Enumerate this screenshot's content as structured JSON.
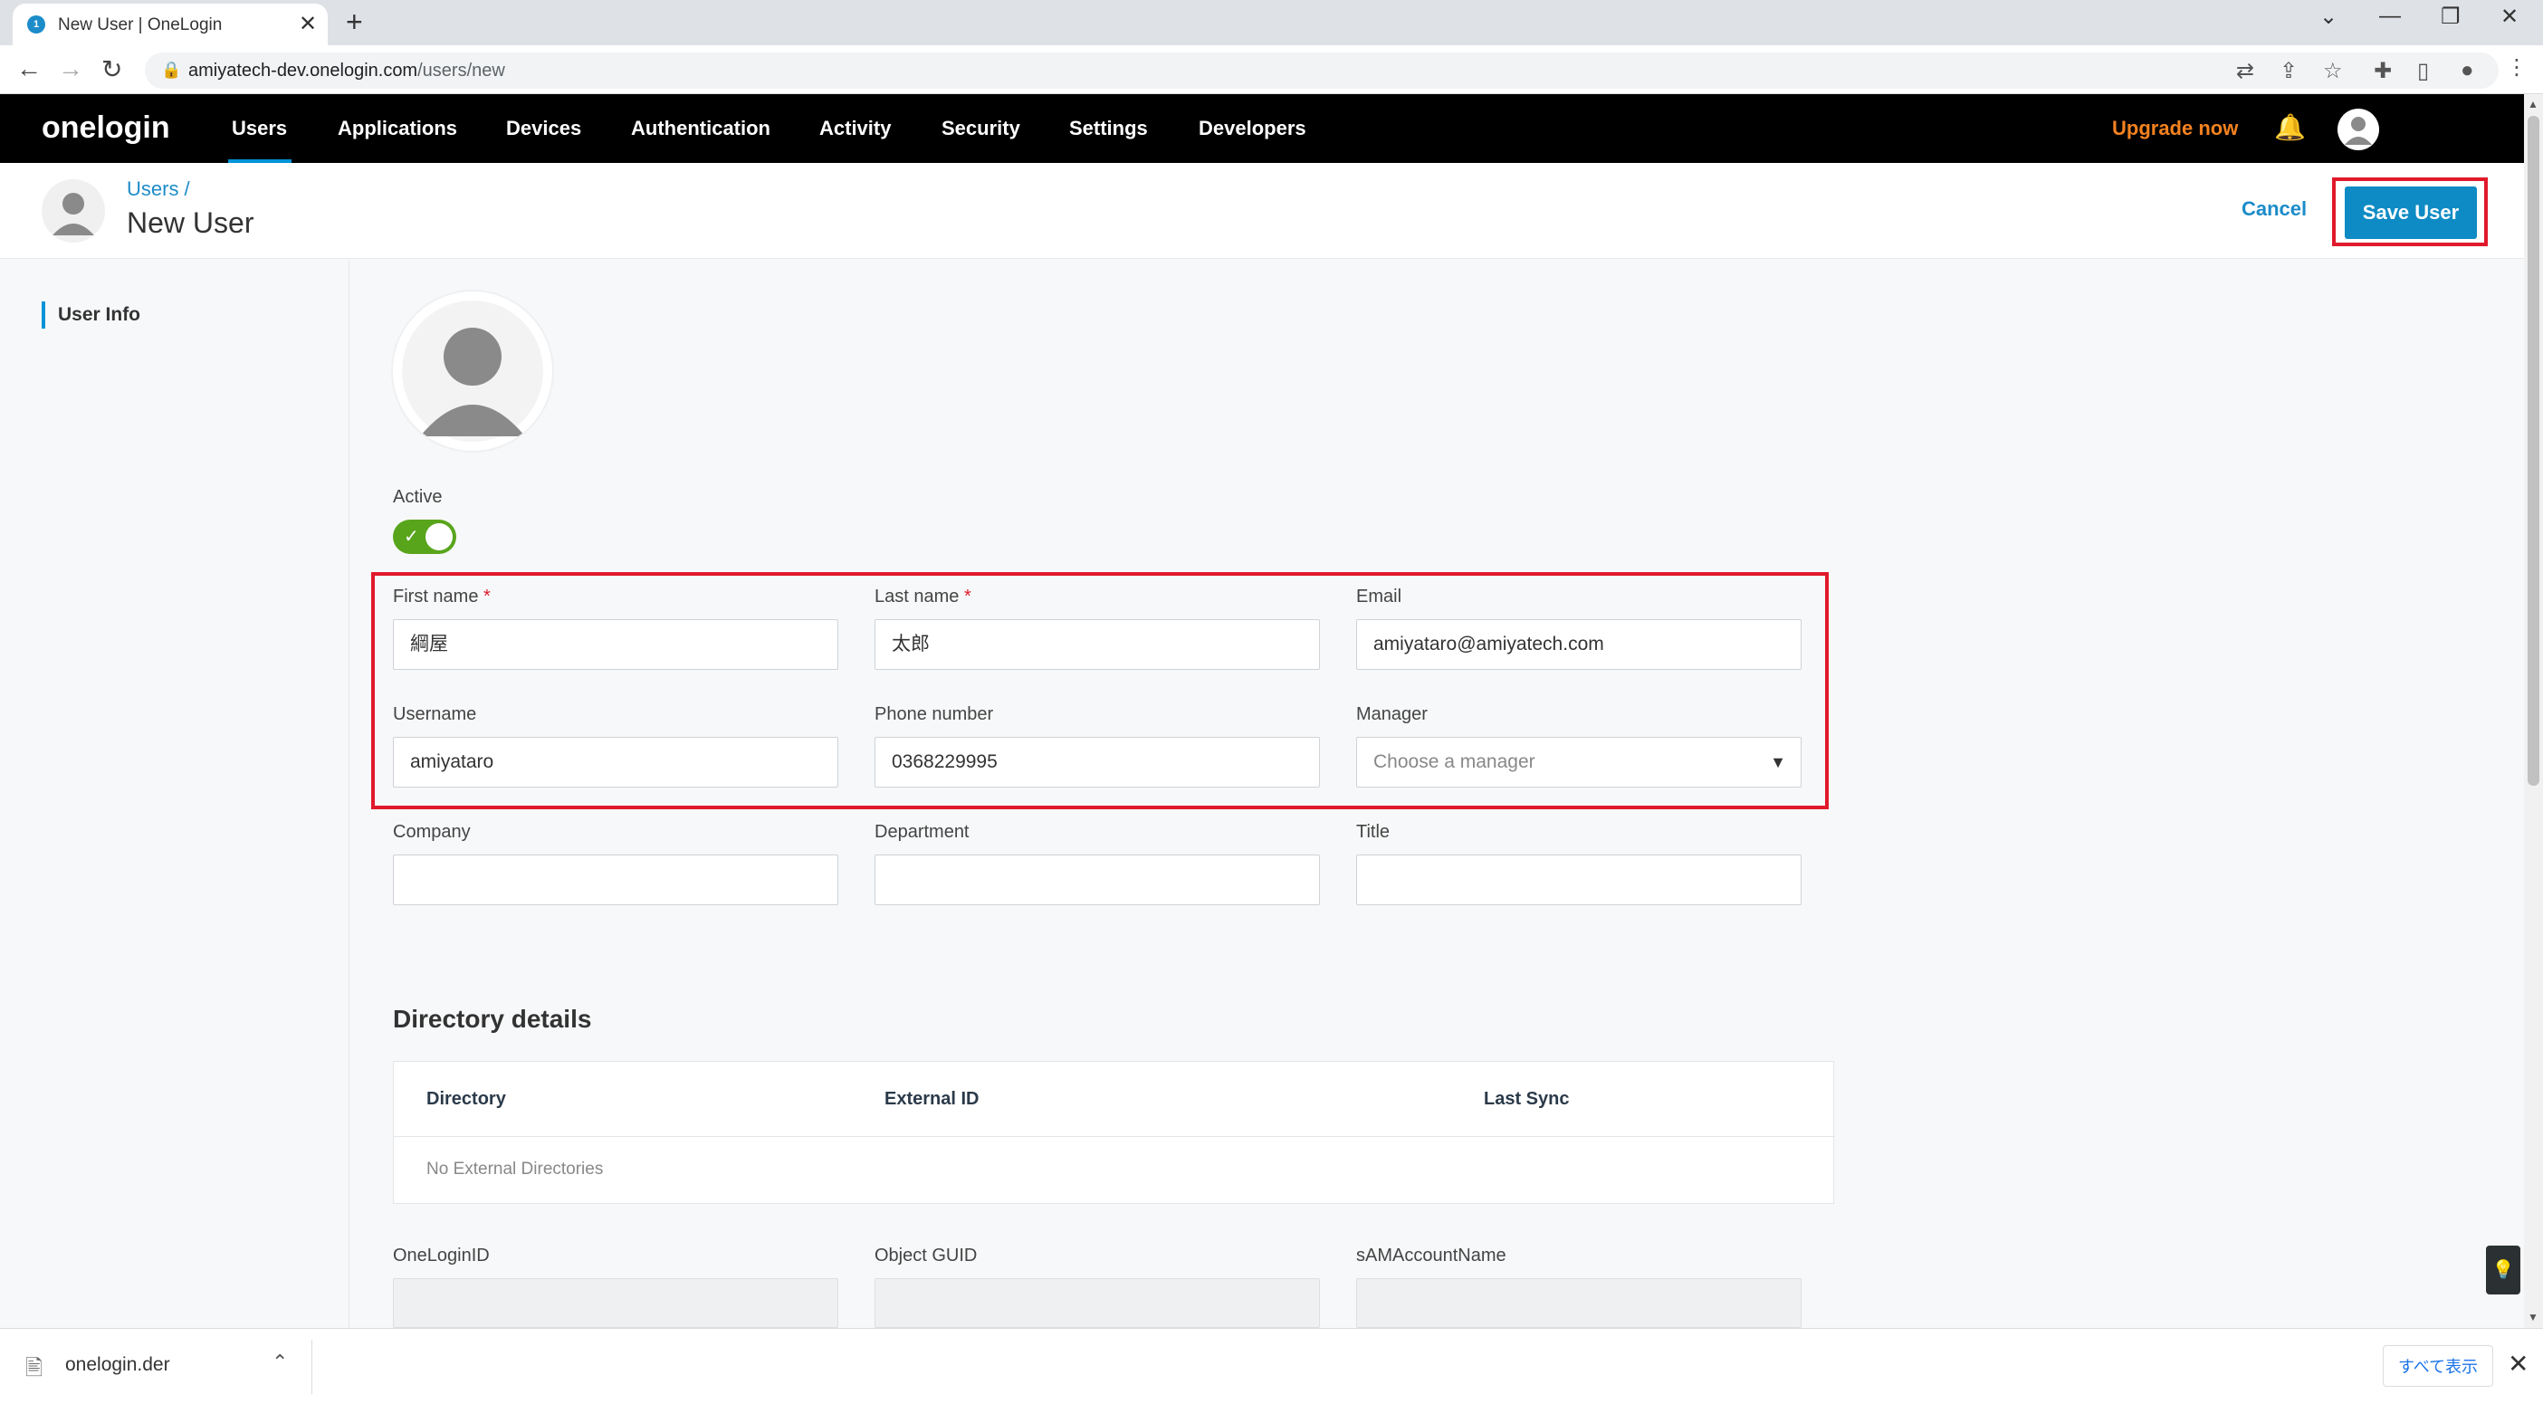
{
  "browser": {
    "tab_title": "New User | OneLogin",
    "url_host": "amiyatech-dev.onelogin.com",
    "url_path": "/users/new"
  },
  "topnav": {
    "logo": "onelogin",
    "items": [
      "Users",
      "Applications",
      "Devices",
      "Authentication",
      "Activity",
      "Security",
      "Settings",
      "Developers"
    ],
    "active": "Users",
    "upgrade": "Upgrade now"
  },
  "header": {
    "breadcrumb": "Users /",
    "title": "New User",
    "cancel": "Cancel",
    "save": "Save User"
  },
  "sidebar": {
    "items": [
      "User Info"
    ]
  },
  "form": {
    "active_label": "Active",
    "active": true,
    "first_name": {
      "label": "First name",
      "required": "*",
      "value": "綱屋"
    },
    "last_name": {
      "label": "Last name",
      "required": "*",
      "value": "太郎"
    },
    "email": {
      "label": "Email",
      "value": "amiyataro@amiyatech.com"
    },
    "username": {
      "label": "Username",
      "value": "amiyataro"
    },
    "phone": {
      "label": "Phone number",
      "value": "0368229995"
    },
    "manager": {
      "label": "Manager",
      "placeholder": "Choose a manager"
    },
    "company": {
      "label": "Company",
      "value": ""
    },
    "department": {
      "label": "Department",
      "value": ""
    },
    "title": {
      "label": "Title",
      "value": ""
    }
  },
  "directory": {
    "section_title": "Directory details",
    "columns": [
      "Directory",
      "External ID",
      "Last Sync"
    ],
    "empty": "No External Directories",
    "fields": {
      "onelogin_id": "OneLoginID",
      "object_guid": "Object GUID",
      "sam": "sAMAccountName"
    }
  },
  "downloads": {
    "file": "onelogin.der",
    "show_all": "すべて表示"
  },
  "icons": {
    "toggle_check": "✓",
    "bell": "bell-icon",
    "help": "lightbulb-icon"
  },
  "colors": {
    "brand_blue": "#0e8bc4",
    "toggle_green": "#58a51c",
    "highlight_red": "#e0192b",
    "upgrade_orange": "#f58220"
  }
}
